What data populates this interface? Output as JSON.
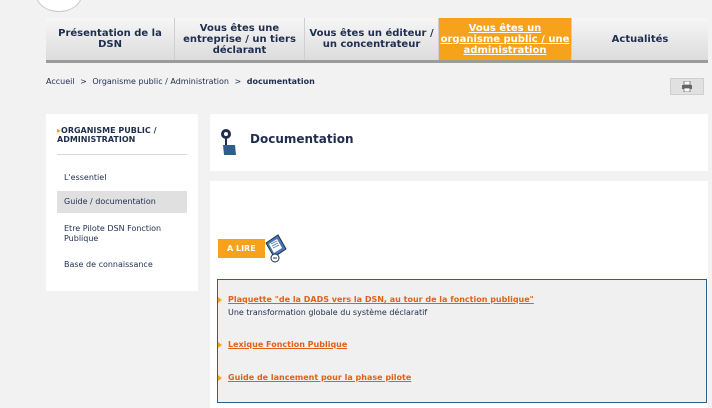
{
  "nav": {
    "items": [
      {
        "label": "Présentation de la DSN"
      },
      {
        "label": "Vous êtes une entreprise / un tiers déclarant"
      },
      {
        "label": "Vous êtes un éditeur / un concentrateur"
      },
      {
        "label": "Vous êtes un organisme public / une administration"
      },
      {
        "label": "Actualités"
      }
    ]
  },
  "breadcrumb": {
    "home": "Accueil",
    "separator": ">",
    "level1": "Organisme public / Administration",
    "current": "documentation"
  },
  "sidebar": {
    "arrow": "▸",
    "title": "ORGANISME PUBLIC / ADMINISTRATION",
    "items": [
      {
        "label": "L'essentiel"
      },
      {
        "label": "Guide / documentation"
      },
      {
        "label": "Etre Pilote DSN Fonction Publique"
      },
      {
        "label": "Base de connaissance"
      }
    ]
  },
  "page": {
    "title": "Documentation",
    "alire_label": "A LIRE"
  },
  "documents": [
    {
      "title": "Plaquette \"de la DADS vers la DSN, au tour de la fonction publique\"",
      "description": "Une transformation globale du système déclaratif"
    },
    {
      "title": "Lexique Fonction Publique"
    },
    {
      "title": "Guide de lancement pour la phase pilote"
    }
  ],
  "colors": {
    "accent": "#f7a21b",
    "navy": "#1f2d4f",
    "link": "#e0611b",
    "box_border": "#2f5d8c"
  },
  "icons": {
    "print": "printer-icon",
    "header": "pin-hand-icon",
    "alire": "clipboard-icon"
  }
}
